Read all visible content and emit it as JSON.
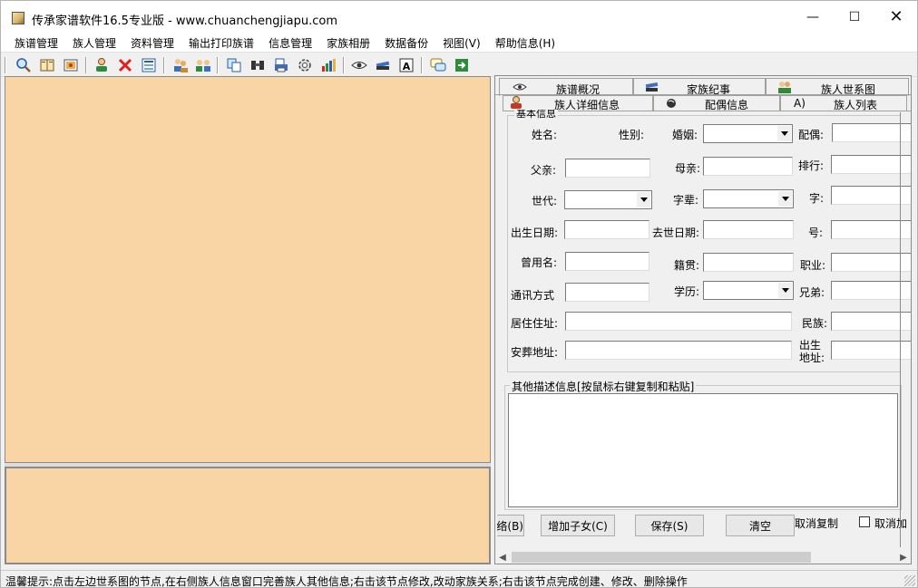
{
  "window": {
    "title": "传承家谱软件16.5专业版 - www.chuanchengjiapu.com",
    "minimize": "—",
    "maximize": "☐",
    "close": "✕"
  },
  "menu": [
    "族谱管理",
    "族人管理",
    "资料管理",
    "输出打印族谱",
    "信息管理",
    "家族相册",
    "数据备份",
    "视图(V)",
    "帮助信息(H)"
  ],
  "toolbar_icons": [
    "search-icon",
    "book-icon",
    "image-icon",
    "add-person-icon",
    "delete-icon",
    "list-icon",
    "people-icon",
    "group-icon",
    "copy-icon",
    "find-icon",
    "print-icon",
    "settings-icon",
    "chart-icon",
    "eye-icon",
    "books-icon",
    "text-icon",
    "chat-icon",
    "exit-icon"
  ],
  "tabs_outer": [
    "族谱概况",
    "家族纪事",
    "族人世系图"
  ],
  "tabs_inner": [
    "族人详细信息",
    "配偶信息",
    "A)",
    "族人列表"
  ],
  "form": {
    "group_title": "基本信息",
    "name_label": "姓名:",
    "gender_label": "性别:",
    "marriage_label": "婚姻:",
    "spouse_label": "配偶:",
    "father_label": "父亲:",
    "mother_label": "母亲:",
    "rank_label": "排行:",
    "generation_label": "世代:",
    "generation_char_label": "字辈:",
    "courtesy_label": "字:",
    "birth_date_label": "出生日期:",
    "death_date_label": "去世日期:",
    "alias_label": "号:",
    "former_name_label": "曾用名:",
    "native_place_label": "籍贯:",
    "occupation_label": "职业:",
    "contact_label": "通讯方式",
    "education_label": "学历:",
    "brothers_label": "兄弟:",
    "residence_label": "居住住址:",
    "ethnicity_label": "民族:",
    "burial_label": "安葬地址:",
    "birthplace_label_1": "出生",
    "birthplace_label_2": "地址:"
  },
  "description": {
    "legend": "其他描述信息[按鼠标右键复制和粘贴]"
  },
  "buttons": {
    "partial_left": "络(B)",
    "add_child": "增加子女(C)",
    "save": "保存(S)",
    "clear": "清空",
    "cancel_copy": "取消复制",
    "cancel_add": "取消加"
  },
  "status": "温馨提示:点击左边世系图的节点,在右侧族人信息窗口完善族人其他信息;右击该节点修改,改动家族关系;右击该节点完成创建、修改、删除操作",
  "colors": {
    "tree_background": "#f9d4a4",
    "window_background": "#f0f0f0"
  }
}
